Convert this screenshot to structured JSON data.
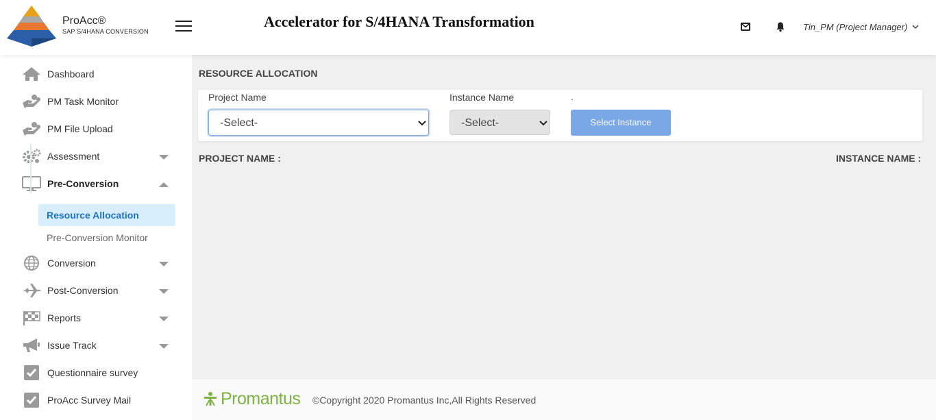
{
  "header": {
    "logo_name": "ProAcc®",
    "logo_subtitle": "SAP S/4HANA CONVERSION",
    "app_title": "Accelerator for S/4HANA Transformation",
    "user": "Tin_PM (Project Manager)",
    "icons": [
      "hamburger-icon",
      "mail-icon",
      "bell-icon",
      "chevron-down-icon"
    ]
  },
  "sidebar": {
    "items": [
      {
        "label": "Dashboard",
        "icon": "home-icon"
      },
      {
        "label": "PM Task Monitor",
        "icon": "hand-coins-icon"
      },
      {
        "label": "PM File Upload",
        "icon": "hand-coins-icon"
      },
      {
        "label": "Assessment",
        "icon": "gears-icon",
        "expandable": true
      },
      {
        "label": "Pre-Conversion",
        "icon": "monitor-icon",
        "expanded": true
      },
      {
        "label": "Conversion",
        "icon": "globe-icon",
        "expandable": true
      },
      {
        "label": "Post-Conversion",
        "icon": "plane-icon",
        "expandable": true
      },
      {
        "label": "Reports",
        "icon": "flag-checkered-icon",
        "expandable": true
      },
      {
        "label": "Issue Track",
        "icon": "megaphone-icon",
        "expandable": true
      },
      {
        "label": "Questionnaire survey",
        "icon": "checkbox-icon"
      },
      {
        "label": "ProAcc Survey Mail",
        "icon": "checkbox-icon"
      }
    ],
    "subitems": [
      {
        "label": "Resource Allocation",
        "active": true
      },
      {
        "label": "Pre-Conversion Monitor",
        "active": false
      }
    ]
  },
  "main": {
    "heading": "RESOURCE ALLOCATION",
    "project_label": "Project Name",
    "project_value": "-Select-",
    "instance_label": "Instance Name",
    "instance_value": "-Select-",
    "dot": ".",
    "button": "Select Instance",
    "project_info": "PROJECT NAME :",
    "instance_info": "INSTANCE NAME :"
  },
  "footer": {
    "brand": "Promantus",
    "copyright": "©Copyright 2020 Promantus Inc,All Rights Reserved"
  },
  "colors": {
    "accent": "#1a73c9",
    "button": "#7aa7e6",
    "active_bg": "#d9eefc",
    "brand_green": "#7cb342"
  }
}
